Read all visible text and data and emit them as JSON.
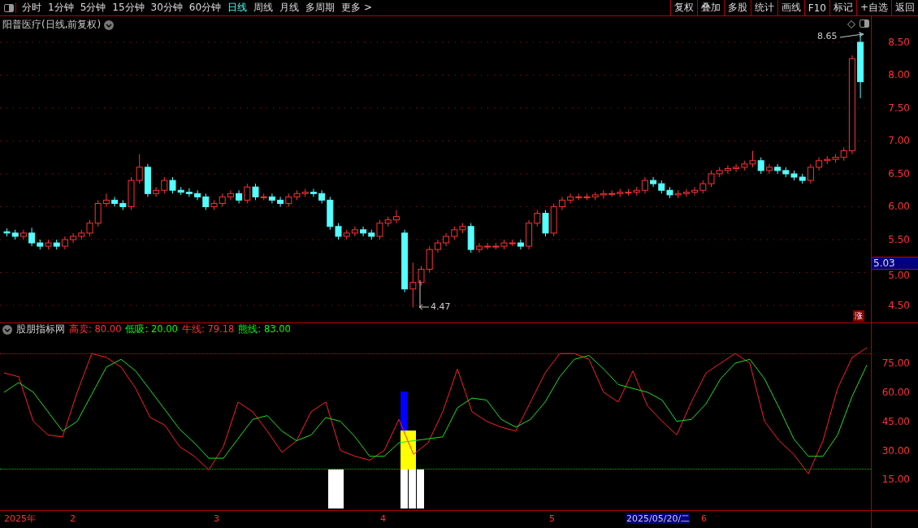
{
  "toolbar": {
    "periods": [
      {
        "label": "分时",
        "selected": false
      },
      {
        "label": "1分钟",
        "selected": false
      },
      {
        "label": "5分钟",
        "selected": false
      },
      {
        "label": "15分钟",
        "selected": false
      },
      {
        "label": "30分钟",
        "selected": false
      },
      {
        "label": "60分钟",
        "selected": false
      },
      {
        "label": "日线",
        "selected": true
      },
      {
        "label": "周线",
        "selected": false
      },
      {
        "label": "月线",
        "selected": false
      },
      {
        "label": "多周期",
        "selected": false
      }
    ],
    "more": "更多 >",
    "buttons": [
      "复权",
      "叠加",
      "多股",
      "统计",
      "画线",
      "F10",
      "标记",
      "+自选",
      "返回"
    ]
  },
  "price_chart": {
    "title": "阳普医疗(日线,前复权)",
    "high_label": "8.65",
    "low_label": "4.47",
    "current_price": "5.03",
    "badge": "涨",
    "chart_data": {
      "type": "candlestick",
      "grid": true,
      "ylim": [
        4.253,
        8.895
      ],
      "yticks": [
        {
          "value": 8.5,
          "label": "8.50"
        },
        {
          "value": 8,
          "label": "8.00"
        },
        {
          "value": 7.5,
          "label": "7.50"
        },
        {
          "value": 7,
          "label": "7.00"
        },
        {
          "value": 6.5,
          "label": "6.50"
        },
        {
          "value": 6,
          "label": "6.00"
        },
        {
          "value": 5.5,
          "label": "5.50"
        },
        {
          "value": 5,
          "label": "5.00"
        },
        {
          "value": 4.5,
          "label": "4.50"
        }
      ],
      "ohlc": [
        [
          5.62,
          5.67,
          5.55,
          5.6
        ],
        [
          5.6,
          5.65,
          5.5,
          5.55
        ],
        [
          5.55,
          5.65,
          5.5,
          5.6
        ],
        [
          5.6,
          5.68,
          5.4,
          5.45
        ],
        [
          5.45,
          5.5,
          5.35,
          5.4
        ],
        [
          5.4,
          5.5,
          5.35,
          5.45
        ],
        [
          5.45,
          5.5,
          5.35,
          5.4
        ],
        [
          5.4,
          5.55,
          5.35,
          5.5
        ],
        [
          5.5,
          5.6,
          5.45,
          5.55
        ],
        [
          5.55,
          5.65,
          5.5,
          5.6
        ],
        [
          5.6,
          5.8,
          5.55,
          5.75
        ],
        [
          5.75,
          6.1,
          5.7,
          6.05
        ],
        [
          6.05,
          6.2,
          6.0,
          6.1
        ],
        [
          6.1,
          6.15,
          6.0,
          6.05
        ],
        [
          6.05,
          6.1,
          5.95,
          6.0
        ],
        [
          6.0,
          6.45,
          5.95,
          6.4
        ],
        [
          6.4,
          6.8,
          6.35,
          6.6
        ],
        [
          6.6,
          6.65,
          6.15,
          6.2
        ],
        [
          6.2,
          6.3,
          6.15,
          6.25
        ],
        [
          6.25,
          6.45,
          6.2,
          6.4
        ],
        [
          6.4,
          6.45,
          6.2,
          6.25
        ],
        [
          6.25,
          6.3,
          6.18,
          6.22
        ],
        [
          6.22,
          6.28,
          6.15,
          6.2
        ],
        [
          6.2,
          6.25,
          6.1,
          6.15
        ],
        [
          6.15,
          6.2,
          5.95,
          6.0
        ],
        [
          6.0,
          6.1,
          5.95,
          6.05
        ],
        [
          6.05,
          6.2,
          6.0,
          6.15
        ],
        [
          6.15,
          6.25,
          6.1,
          6.2
        ],
        [
          6.2,
          6.25,
          6.05,
          6.1
        ],
        [
          6.1,
          6.35,
          6.05,
          6.3
        ],
        [
          6.3,
          6.35,
          6.1,
          6.15
        ],
        [
          6.15,
          6.2,
          6.1,
          6.15
        ],
        [
          6.15,
          6.2,
          6.05,
          6.1
        ],
        [
          6.1,
          6.15,
          6.0,
          6.05
        ],
        [
          6.05,
          6.2,
          6.0,
          6.15
        ],
        [
          6.15,
          6.25,
          6.1,
          6.2
        ],
        [
          6.2,
          6.27,
          6.15,
          6.22
        ],
        [
          6.22,
          6.27,
          6.15,
          6.2
        ],
        [
          6.2,
          6.25,
          6.05,
          6.1
        ],
        [
          6.1,
          6.15,
          5.65,
          5.7
        ],
        [
          5.7,
          5.75,
          5.5,
          5.55
        ],
        [
          5.55,
          5.65,
          5.5,
          5.6
        ],
        [
          5.6,
          5.7,
          5.55,
          5.65
        ],
        [
          5.65,
          5.7,
          5.55,
          5.6
        ],
        [
          5.6,
          5.65,
          5.5,
          5.55
        ],
        [
          5.55,
          5.8,
          5.5,
          5.75
        ],
        [
          5.75,
          5.85,
          5.7,
          5.8
        ],
        [
          5.8,
          5.95,
          5.75,
          5.85
        ],
        [
          5.6,
          5.65,
          4.7,
          4.75
        ],
        [
          4.75,
          5.15,
          4.47,
          4.85
        ],
        [
          4.85,
          5.1,
          4.8,
          5.05
        ],
        [
          5.05,
          5.4,
          5.0,
          5.35
        ],
        [
          5.35,
          5.5,
          5.3,
          5.45
        ],
        [
          5.45,
          5.6,
          5.4,
          5.55
        ],
        [
          5.55,
          5.7,
          5.5,
          5.65
        ],
        [
          5.65,
          5.75,
          5.6,
          5.7
        ],
        [
          5.7,
          5.75,
          5.3,
          5.35
        ],
        [
          5.35,
          5.45,
          5.3,
          5.4
        ],
        [
          5.4,
          5.45,
          5.35,
          5.4
        ],
        [
          5.4,
          5.45,
          5.35,
          5.4
        ],
        [
          5.4,
          5.5,
          5.35,
          5.45
        ],
        [
          5.45,
          5.5,
          5.4,
          5.45
        ],
        [
          5.45,
          5.5,
          5.35,
          5.4
        ],
        [
          5.4,
          5.8,
          5.35,
          5.75
        ],
        [
          5.75,
          5.95,
          5.7,
          5.9
        ],
        [
          5.9,
          5.95,
          5.55,
          5.6
        ],
        [
          5.6,
          6.05,
          5.55,
          6.0
        ],
        [
          6.0,
          6.15,
          5.95,
          6.1
        ],
        [
          6.1,
          6.2,
          6.05,
          6.15
        ],
        [
          6.15,
          6.2,
          6.1,
          6.15
        ],
        [
          6.15,
          6.2,
          6.1,
          6.15
        ],
        [
          6.15,
          6.22,
          6.1,
          6.18
        ],
        [
          6.18,
          6.25,
          6.12,
          6.2
        ],
        [
          6.2,
          6.25,
          6.15,
          6.2
        ],
        [
          6.2,
          6.27,
          6.15,
          6.22
        ],
        [
          6.22,
          6.27,
          6.17,
          6.22
        ],
        [
          6.22,
          6.3,
          6.17,
          6.25
        ],
        [
          6.25,
          6.45,
          6.2,
          6.4
        ],
        [
          6.4,
          6.45,
          6.3,
          6.35
        ],
        [
          6.35,
          6.4,
          6.2,
          6.25
        ],
        [
          6.25,
          6.3,
          6.13,
          6.18
        ],
        [
          6.18,
          6.25,
          6.13,
          6.2
        ],
        [
          6.2,
          6.27,
          6.15,
          6.22
        ],
        [
          6.22,
          6.3,
          6.17,
          6.25
        ],
        [
          6.25,
          6.4,
          6.2,
          6.35
        ],
        [
          6.35,
          6.55,
          6.3,
          6.5
        ],
        [
          6.5,
          6.6,
          6.45,
          6.55
        ],
        [
          6.55,
          6.63,
          6.5,
          6.58
        ],
        [
          6.58,
          6.65,
          6.53,
          6.6
        ],
        [
          6.6,
          6.7,
          6.55,
          6.65
        ],
        [
          6.65,
          6.85,
          6.6,
          6.7
        ],
        [
          6.7,
          6.75,
          6.5,
          6.55
        ],
        [
          6.55,
          6.65,
          6.5,
          6.6
        ],
        [
          6.6,
          6.65,
          6.5,
          6.55
        ],
        [
          6.55,
          6.6,
          6.45,
          6.5
        ],
        [
          6.5,
          6.55,
          6.4,
          6.45
        ],
        [
          6.45,
          6.5,
          6.35,
          6.4
        ],
        [
          6.4,
          6.65,
          6.35,
          6.6
        ],
        [
          6.6,
          6.75,
          6.55,
          6.7
        ],
        [
          6.7,
          6.77,
          6.65,
          6.72
        ],
        [
          6.72,
          6.8,
          6.67,
          6.75
        ],
        [
          6.75,
          6.9,
          6.7,
          6.85
        ],
        [
          6.85,
          8.3,
          6.8,
          8.25
        ],
        [
          8.5,
          8.65,
          7.65,
          7.9
        ]
      ]
    }
  },
  "indicator": {
    "name": "股朋指标网",
    "legend": [
      {
        "label": "高卖: 80.00",
        "color": "#ff3232"
      },
      {
        "label": "低吸: 20.00",
        "color": "#00ff00"
      },
      {
        "label": "牛线: 79.18",
        "color": "#ff3232"
      },
      {
        "label": "熊线: 83.00",
        "color": "#00ff00"
      }
    ],
    "chart_data": {
      "type": "line",
      "ylim": [
        -10,
        96
      ],
      "yticks": [
        {
          "value": 75,
          "label": "75.00"
        },
        {
          "value": 60,
          "label": "60.00"
        },
        {
          "value": 45,
          "label": "45.00"
        },
        {
          "value": 30,
          "label": "30.00"
        },
        {
          "value": 15,
          "label": "15.00"
        }
      ],
      "series": [
        {
          "color": "#ff2020",
          "values": [
            70,
            68,
            45,
            38,
            37,
            60,
            80,
            78,
            73,
            62,
            47,
            43,
            32,
            27,
            20,
            32,
            55,
            50,
            40,
            29,
            35,
            50,
            55,
            30,
            27,
            25,
            30,
            46,
            28,
            34,
            50,
            72,
            50,
            45,
            42,
            40,
            55,
            70,
            80,
            80,
            77,
            60,
            55,
            71,
            53,
            45,
            38,
            55,
            70,
            75,
            80,
            75,
            45,
            35,
            28,
            18,
            35,
            62,
            78,
            83
          ]
        },
        {
          "color": "#20e020",
          "values": [
            60,
            65,
            60,
            50,
            40,
            45,
            59,
            73,
            77,
            71,
            61,
            51,
            41,
            34,
            26,
            26,
            36,
            46,
            48,
            40,
            35,
            38,
            47,
            45,
            37,
            27,
            27,
            34,
            35,
            36,
            37,
            52,
            57,
            56,
            46,
            42,
            46,
            55,
            68,
            77,
            79,
            72,
            64,
            62,
            60,
            56,
            45,
            46,
            54,
            67,
            75,
            77,
            67,
            52,
            36,
            27,
            27,
            38,
            58,
            74
          ]
        }
      ]
    }
  },
  "date_axis": [
    {
      "label": "2025年",
      "selected": false
    },
    {
      "label": "2",
      "selected": false
    },
    {
      "label": "3",
      "selected": false
    },
    {
      "label": "4",
      "selected": false
    },
    {
      "label": "5",
      "selected": false
    },
    {
      "label": "2025/05/20/二",
      "selected": true
    },
    {
      "label": "6",
      "selected": false
    }
  ]
}
